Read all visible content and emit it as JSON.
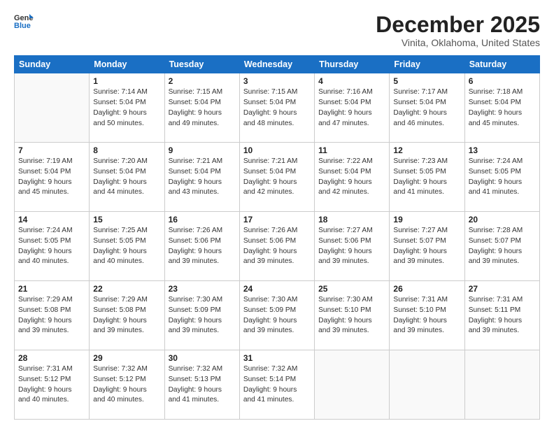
{
  "header": {
    "logo_line1": "General",
    "logo_line2": "Blue",
    "month": "December 2025",
    "location": "Vinita, Oklahoma, United States"
  },
  "weekdays": [
    "Sunday",
    "Monday",
    "Tuesday",
    "Wednesday",
    "Thursday",
    "Friday",
    "Saturday"
  ],
  "weeks": [
    [
      {
        "day": "",
        "lines": []
      },
      {
        "day": "1",
        "lines": [
          "Sunrise: 7:14 AM",
          "Sunset: 5:04 PM",
          "Daylight: 9 hours",
          "and 50 minutes."
        ]
      },
      {
        "day": "2",
        "lines": [
          "Sunrise: 7:15 AM",
          "Sunset: 5:04 PM",
          "Daylight: 9 hours",
          "and 49 minutes."
        ]
      },
      {
        "day": "3",
        "lines": [
          "Sunrise: 7:15 AM",
          "Sunset: 5:04 PM",
          "Daylight: 9 hours",
          "and 48 minutes."
        ]
      },
      {
        "day": "4",
        "lines": [
          "Sunrise: 7:16 AM",
          "Sunset: 5:04 PM",
          "Daylight: 9 hours",
          "and 47 minutes."
        ]
      },
      {
        "day": "5",
        "lines": [
          "Sunrise: 7:17 AM",
          "Sunset: 5:04 PM",
          "Daylight: 9 hours",
          "and 46 minutes."
        ]
      },
      {
        "day": "6",
        "lines": [
          "Sunrise: 7:18 AM",
          "Sunset: 5:04 PM",
          "Daylight: 9 hours",
          "and 45 minutes."
        ]
      }
    ],
    [
      {
        "day": "7",
        "lines": [
          "Sunrise: 7:19 AM",
          "Sunset: 5:04 PM",
          "Daylight: 9 hours",
          "and 45 minutes."
        ]
      },
      {
        "day": "8",
        "lines": [
          "Sunrise: 7:20 AM",
          "Sunset: 5:04 PM",
          "Daylight: 9 hours",
          "and 44 minutes."
        ]
      },
      {
        "day": "9",
        "lines": [
          "Sunrise: 7:21 AM",
          "Sunset: 5:04 PM",
          "Daylight: 9 hours",
          "and 43 minutes."
        ]
      },
      {
        "day": "10",
        "lines": [
          "Sunrise: 7:21 AM",
          "Sunset: 5:04 PM",
          "Daylight: 9 hours",
          "and 42 minutes."
        ]
      },
      {
        "day": "11",
        "lines": [
          "Sunrise: 7:22 AM",
          "Sunset: 5:04 PM",
          "Daylight: 9 hours",
          "and 42 minutes."
        ]
      },
      {
        "day": "12",
        "lines": [
          "Sunrise: 7:23 AM",
          "Sunset: 5:05 PM",
          "Daylight: 9 hours",
          "and 41 minutes."
        ]
      },
      {
        "day": "13",
        "lines": [
          "Sunrise: 7:24 AM",
          "Sunset: 5:05 PM",
          "Daylight: 9 hours",
          "and 41 minutes."
        ]
      }
    ],
    [
      {
        "day": "14",
        "lines": [
          "Sunrise: 7:24 AM",
          "Sunset: 5:05 PM",
          "Daylight: 9 hours",
          "and 40 minutes."
        ]
      },
      {
        "day": "15",
        "lines": [
          "Sunrise: 7:25 AM",
          "Sunset: 5:05 PM",
          "Daylight: 9 hours",
          "and 40 minutes."
        ]
      },
      {
        "day": "16",
        "lines": [
          "Sunrise: 7:26 AM",
          "Sunset: 5:06 PM",
          "Daylight: 9 hours",
          "and 39 minutes."
        ]
      },
      {
        "day": "17",
        "lines": [
          "Sunrise: 7:26 AM",
          "Sunset: 5:06 PM",
          "Daylight: 9 hours",
          "and 39 minutes."
        ]
      },
      {
        "day": "18",
        "lines": [
          "Sunrise: 7:27 AM",
          "Sunset: 5:06 PM",
          "Daylight: 9 hours",
          "and 39 minutes."
        ]
      },
      {
        "day": "19",
        "lines": [
          "Sunrise: 7:27 AM",
          "Sunset: 5:07 PM",
          "Daylight: 9 hours",
          "and 39 minutes."
        ]
      },
      {
        "day": "20",
        "lines": [
          "Sunrise: 7:28 AM",
          "Sunset: 5:07 PM",
          "Daylight: 9 hours",
          "and 39 minutes."
        ]
      }
    ],
    [
      {
        "day": "21",
        "lines": [
          "Sunrise: 7:29 AM",
          "Sunset: 5:08 PM",
          "Daylight: 9 hours",
          "and 39 minutes."
        ]
      },
      {
        "day": "22",
        "lines": [
          "Sunrise: 7:29 AM",
          "Sunset: 5:08 PM",
          "Daylight: 9 hours",
          "and 39 minutes."
        ]
      },
      {
        "day": "23",
        "lines": [
          "Sunrise: 7:30 AM",
          "Sunset: 5:09 PM",
          "Daylight: 9 hours",
          "and 39 minutes."
        ]
      },
      {
        "day": "24",
        "lines": [
          "Sunrise: 7:30 AM",
          "Sunset: 5:09 PM",
          "Daylight: 9 hours",
          "and 39 minutes."
        ]
      },
      {
        "day": "25",
        "lines": [
          "Sunrise: 7:30 AM",
          "Sunset: 5:10 PM",
          "Daylight: 9 hours",
          "and 39 minutes."
        ]
      },
      {
        "day": "26",
        "lines": [
          "Sunrise: 7:31 AM",
          "Sunset: 5:10 PM",
          "Daylight: 9 hours",
          "and 39 minutes."
        ]
      },
      {
        "day": "27",
        "lines": [
          "Sunrise: 7:31 AM",
          "Sunset: 5:11 PM",
          "Daylight: 9 hours",
          "and 39 minutes."
        ]
      }
    ],
    [
      {
        "day": "28",
        "lines": [
          "Sunrise: 7:31 AM",
          "Sunset: 5:12 PM",
          "Daylight: 9 hours",
          "and 40 minutes."
        ]
      },
      {
        "day": "29",
        "lines": [
          "Sunrise: 7:32 AM",
          "Sunset: 5:12 PM",
          "Daylight: 9 hours",
          "and 40 minutes."
        ]
      },
      {
        "day": "30",
        "lines": [
          "Sunrise: 7:32 AM",
          "Sunset: 5:13 PM",
          "Daylight: 9 hours",
          "and 41 minutes."
        ]
      },
      {
        "day": "31",
        "lines": [
          "Sunrise: 7:32 AM",
          "Sunset: 5:14 PM",
          "Daylight: 9 hours",
          "and 41 minutes."
        ]
      },
      {
        "day": "",
        "lines": []
      },
      {
        "day": "",
        "lines": []
      },
      {
        "day": "",
        "lines": []
      }
    ]
  ]
}
